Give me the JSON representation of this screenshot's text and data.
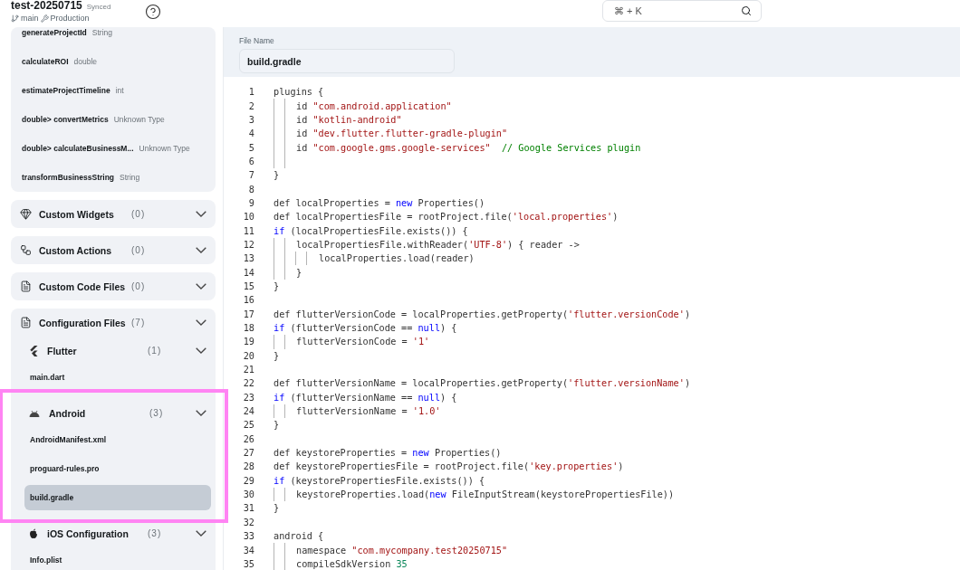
{
  "header": {
    "project": "test-20250715",
    "sync_status": "Synced",
    "branch": "main",
    "environment": "Production"
  },
  "search": {
    "placeholder": "⌘ + K"
  },
  "functions": [
    {
      "name": "generateProjectId",
      "type": "String"
    },
    {
      "name": "calculateROI",
      "type": "double"
    },
    {
      "name": "estimateProjectTimeline",
      "type": "int"
    },
    {
      "name": "double> convertMetrics",
      "type": "Unknown Type"
    },
    {
      "name": "double> calculateBusinessM...",
      "type": "Unknown Type"
    },
    {
      "name": "transformBusinessString",
      "type": "String"
    }
  ],
  "sections": [
    {
      "kind": "widgets",
      "title": "Custom Widgets",
      "count": "(0)"
    },
    {
      "kind": "actions",
      "title": "Custom Actions",
      "count": "(0)"
    },
    {
      "kind": "file",
      "title": "Custom Code Files",
      "count": "(0)"
    },
    {
      "kind": "file",
      "title": "Configuration Files",
      "count": "(7)",
      "groups": [
        {
          "kind": "flutter",
          "title": "Flutter",
          "count": "(1)",
          "files": [
            {
              "name": "main.dart",
              "selected": false
            }
          ]
        },
        {
          "kind": "android",
          "title": "Android",
          "count": "(3)",
          "highlighted": true,
          "files": [
            {
              "name": "AndroidManifest.xml",
              "selected": false
            },
            {
              "name": "proguard-rules.pro",
              "selected": false
            },
            {
              "name": "build.gradle",
              "selected": true
            }
          ]
        },
        {
          "kind": "apple",
          "title": "iOS Configuration",
          "count": "(3)",
          "files": [
            {
              "name": "Info.plist",
              "selected": false
            }
          ]
        }
      ]
    }
  ],
  "file_name": {
    "label": "File Name",
    "value": "build.gradle"
  },
  "code": [
    {
      "n": "1",
      "tokens": [
        {
          "kind": "plain",
          "text": "plugins {"
        }
      ],
      "children": [
        {
          "n": "2",
          "tokens": [
            {
              "kind": "plain",
              "text": "id "
            },
            {
              "kind": "string",
              "text": "\"com.android.application\""
            }
          ]
        },
        {
          "n": "3",
          "tokens": [
            {
              "kind": "plain",
              "text": "id "
            },
            {
              "kind": "string",
              "text": "\"kotlin-android\""
            }
          ]
        },
        {
          "n": "4",
          "tokens": [
            {
              "kind": "plain",
              "text": "id "
            },
            {
              "kind": "string",
              "text": "\"dev.flutter.flutter-gradle-plugin\""
            }
          ]
        },
        {
          "n": "5",
          "tokens": [
            {
              "kind": "plain",
              "text": "id "
            },
            {
              "kind": "string",
              "text": "\"com.google.gms.google-services\""
            },
            {
              "kind": "comment",
              "text": "  // Google Services plugin"
            }
          ]
        },
        {
          "n": "6"
        }
      ]
    },
    {
      "n": "7",
      "tokens": [
        {
          "kind": "plain",
          "text": "}"
        }
      ]
    },
    {
      "n": "8"
    },
    {
      "n": "9",
      "tokens": [
        {
          "kind": "plain",
          "text": "def localProperties = "
        },
        {
          "kind": "keyword",
          "text": "new"
        },
        {
          "kind": "plain",
          "text": " Properties()"
        }
      ]
    },
    {
      "n": "10",
      "tokens": [
        {
          "kind": "plain",
          "text": "def localPropertiesFile = rootProject.file("
        },
        {
          "kind": "string",
          "text": "'local.properties'"
        },
        {
          "kind": "plain",
          "text": ")"
        }
      ]
    },
    {
      "n": "11",
      "tokens": [
        {
          "kind": "keyword",
          "text": "if"
        },
        {
          "kind": "plain",
          "text": " (localPropertiesFile.exists()) {"
        }
      ],
      "children": [
        {
          "n": "12",
          "tokens": [
            {
              "kind": "plain",
              "text": "localPropertiesFile.withReader("
            },
            {
              "kind": "string",
              "text": "'UTF-8'"
            },
            {
              "kind": "plain",
              "text": ") { reader ->"
            }
          ],
          "children": [
            {
              "n": "13",
              "tokens": [
                {
                  "kind": "plain",
                  "text": "localProperties.load(reader)"
                }
              ]
            }
          ]
        },
        {
          "n": "14",
          "tokens": [
            {
              "kind": "plain",
              "text": "}"
            }
          ]
        }
      ]
    },
    {
      "n": "15",
      "tokens": [
        {
          "kind": "plain",
          "text": "}"
        }
      ]
    },
    {
      "n": "16"
    },
    {
      "n": "17",
      "tokens": [
        {
          "kind": "plain",
          "text": "def flutterVersionCode = localProperties.getProperty("
        },
        {
          "kind": "string",
          "text": "'flutter.versionCode'"
        },
        {
          "kind": "plain",
          "text": ")"
        }
      ]
    },
    {
      "n": "18",
      "tokens": [
        {
          "kind": "keyword",
          "text": "if"
        },
        {
          "kind": "plain",
          "text": " (flutterVersionCode == "
        },
        {
          "kind": "keyword",
          "text": "null"
        },
        {
          "kind": "plain",
          "text": ") {"
        }
      ],
      "children": [
        {
          "n": "19",
          "tokens": [
            {
              "kind": "plain",
              "text": "flutterVersionCode = "
            },
            {
              "kind": "string",
              "text": "'1'"
            }
          ]
        }
      ]
    },
    {
      "n": "20",
      "tokens": [
        {
          "kind": "plain",
          "text": "}"
        }
      ]
    },
    {
      "n": "21"
    },
    {
      "n": "22",
      "tokens": [
        {
          "kind": "plain",
          "text": "def flutterVersionName = localProperties.getProperty("
        },
        {
          "kind": "string",
          "text": "'flutter.versionName'"
        },
        {
          "kind": "plain",
          "text": ")"
        }
      ]
    },
    {
      "n": "23",
      "tokens": [
        {
          "kind": "keyword",
          "text": "if"
        },
        {
          "kind": "plain",
          "text": " (flutterVersionName == "
        },
        {
          "kind": "keyword",
          "text": "null"
        },
        {
          "kind": "plain",
          "text": ") {"
        }
      ],
      "children": [
        {
          "n": "24",
          "tokens": [
            {
              "kind": "plain",
              "text": "flutterVersionName = "
            },
            {
              "kind": "string",
              "text": "'1.0'"
            }
          ]
        }
      ]
    },
    {
      "n": "25",
      "tokens": [
        {
          "kind": "plain",
          "text": "}"
        }
      ]
    },
    {
      "n": "26"
    },
    {
      "n": "27",
      "tokens": [
        {
          "kind": "plain",
          "text": "def keystoreProperties = "
        },
        {
          "kind": "keyword",
          "text": "new"
        },
        {
          "kind": "plain",
          "text": " Properties()"
        }
      ]
    },
    {
      "n": "28",
      "tokens": [
        {
          "kind": "plain",
          "text": "def keystorePropertiesFile = rootProject.file("
        },
        {
          "kind": "string",
          "text": "'key.properties'"
        },
        {
          "kind": "plain",
          "text": ")"
        }
      ]
    },
    {
      "n": "29",
      "tokens": [
        {
          "kind": "keyword",
          "text": "if"
        },
        {
          "kind": "plain",
          "text": " (keystorePropertiesFile.exists()) {"
        }
      ],
      "children": [
        {
          "n": "30",
          "tokens": [
            {
              "kind": "plain",
              "text": "keystoreProperties.load("
            },
            {
              "kind": "keyword",
              "text": "new"
            },
            {
              "kind": "plain",
              "text": " FileInputStream(keystorePropertiesFile))"
            }
          ]
        }
      ]
    },
    {
      "n": "31",
      "tokens": [
        {
          "kind": "plain",
          "text": "}"
        }
      ]
    },
    {
      "n": "32"
    },
    {
      "n": "33",
      "tokens": [
        {
          "kind": "plain",
          "text": "android {"
        }
      ],
      "children": [
        {
          "n": "34",
          "tokens": [
            {
              "kind": "plain",
              "text": "namespace "
            },
            {
              "kind": "string",
              "text": "\"com.mycompany.test20250715\""
            }
          ]
        },
        {
          "n": "35",
          "tokens": [
            {
              "kind": "plain",
              "text": "compileSdkVersion "
            },
            {
              "kind": "number",
              "text": "35"
            }
          ]
        }
      ]
    }
  ]
}
